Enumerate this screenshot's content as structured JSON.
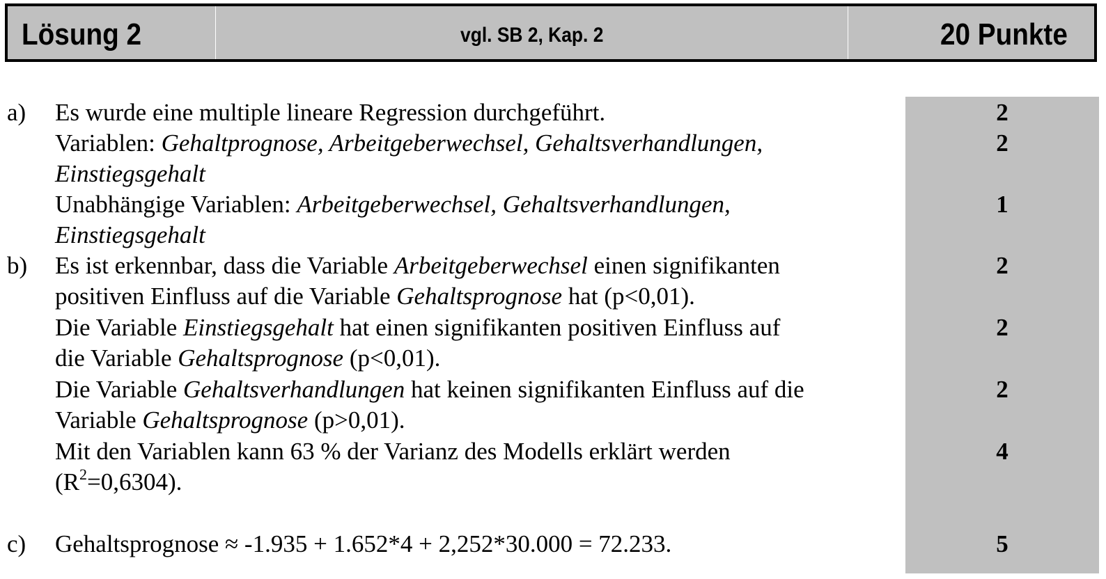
{
  "header": {
    "title": "Lösung 2",
    "reference": "vgl. SB 2, Kap. 2",
    "points": "20 Punkte"
  },
  "sections": {
    "a": {
      "label": "a)",
      "l1": "Es wurde eine multiple lineare Regression durchgeführt.",
      "l2_prefix": "Variablen: ",
      "l2_italic": "Gehaltprognose, Arbeitgeberwechsel, Gehaltsverhandlungen,",
      "l3_italic": "Einstiegsgehalt",
      "l4_prefix": "Unabhängige Variablen: ",
      "l4_italic": "Arbeitgeberwechsel, Gehaltsverhandlungen,",
      "l5_italic": "Einstiegsgehalt",
      "points": [
        "2",
        "2",
        "1"
      ]
    },
    "b": {
      "label": "b)",
      "l1_a": "Es ist erkennbar, dass die Variable ",
      "l1_i": "Arbeitgeberwechsel",
      "l1_b": " einen signifikanten",
      "l2_a": "positiven Einfluss auf die Variable ",
      "l2_i": "Gehaltsprognose",
      "l2_b": " hat (p<0,01).",
      "l3_a": "Die Variable ",
      "l3_i": "Einstiegsgehalt",
      "l3_b": " hat einen signifikanten positiven Einfluss auf",
      "l4_a": "die Variable ",
      "l4_i": "Gehaltsprognose",
      "l4_b": " (p<0,01).",
      "l5_a": "Die Variable ",
      "l5_i": "Gehaltsverhandlungen",
      "l5_b": " hat keinen signifikanten Einfluss auf die",
      "l6_a": "Variable ",
      "l6_i": "Gehaltsprognose",
      "l6_b": " (p>0,01).",
      "l7": "Mit den Variablen kann 63 % der Varianz des Modells erklärt werden",
      "l8_a": "(R",
      "l8_sup": "2",
      "l8_b": "=0,6304).",
      "points": [
        "2",
        "2",
        "2",
        "4"
      ]
    },
    "c": {
      "label": "c)",
      "l1": "Gehaltsprognose ≈ -1.935 + 1.652*4 + 2,252*30.000 = 72.233.",
      "points": [
        "5"
      ]
    }
  }
}
